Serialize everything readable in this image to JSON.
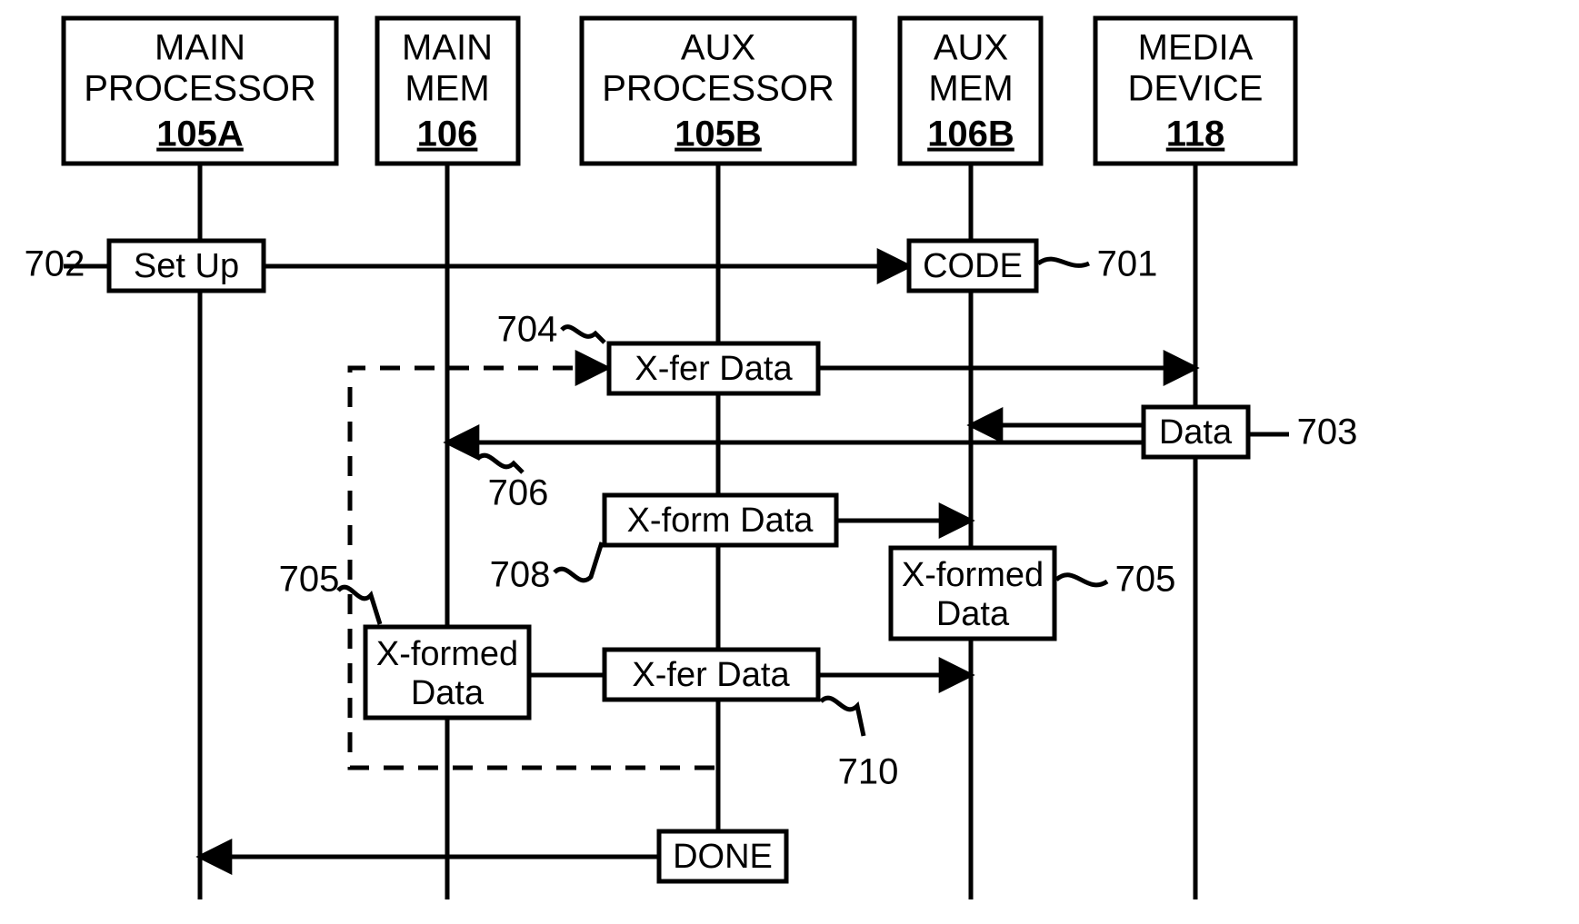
{
  "headers": {
    "main_proc": {
      "l1": "MAIN",
      "l2": "PROCESSOR",
      "ref": "105A"
    },
    "main_mem": {
      "l1": "MAIN",
      "l2": "MEM",
      "ref": "106"
    },
    "aux_proc": {
      "l1": "AUX",
      "l2": "PROCESSOR",
      "ref": "105B"
    },
    "aux_mem": {
      "l1": "AUX",
      "l2": "MEM",
      "ref": "106B"
    },
    "media_dev": {
      "l1": "MEDIA",
      "l2": "DEVICE",
      "ref": "118"
    }
  },
  "nodes": {
    "setup": "Set Up",
    "code": "CODE",
    "xfer1": "X-fer Data",
    "data": "Data",
    "xform": "X-form Data",
    "xformed_l1": "X-formed",
    "xformed_l2": "Data",
    "xfer2": "X-fer Data",
    "done": "DONE"
  },
  "labels": {
    "r702": "702",
    "r701": "701",
    "r704": "704",
    "r703": "703",
    "r706": "706",
    "r705a": "705",
    "r705b": "705",
    "r708": "708",
    "r710": "710"
  }
}
